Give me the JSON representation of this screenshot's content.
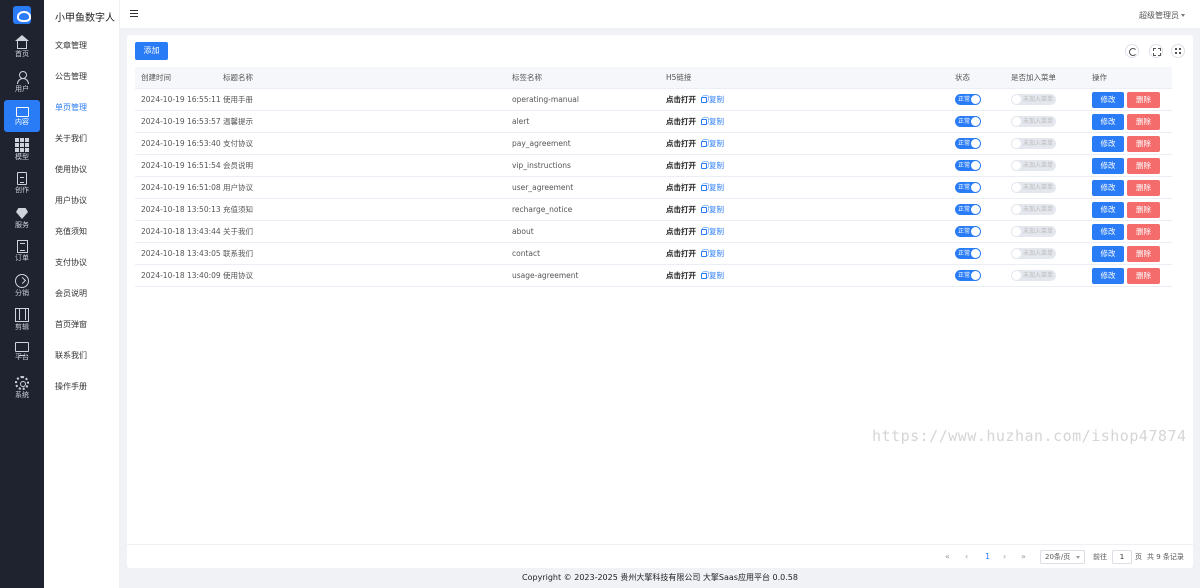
{
  "rail": {
    "items": [
      {
        "label": "首页",
        "icon": "home-icon"
      },
      {
        "label": "用户",
        "icon": "user-icon"
      },
      {
        "label": "内容",
        "icon": "folder-icon"
      },
      {
        "label": "模型",
        "icon": "grid-icon"
      },
      {
        "label": "创作",
        "icon": "document-icon"
      },
      {
        "label": "服务",
        "icon": "gem-icon"
      },
      {
        "label": "订单",
        "icon": "book-icon"
      },
      {
        "label": "分销",
        "icon": "share-icon"
      },
      {
        "label": "剪辑",
        "icon": "film-icon"
      },
      {
        "label": "平台",
        "icon": "monitor-icon"
      },
      {
        "label": "系统",
        "icon": "gear-icon"
      }
    ],
    "active_index": 2,
    "accent": "#2a7cf6"
  },
  "submenu": {
    "title": "小甲鱼数字人",
    "items": [
      "文章管理",
      "公告管理",
      "单页管理",
      "关于我们",
      "使用协议",
      "用户协议",
      "充值须知",
      "支付协议",
      "会员说明",
      "首页弹窗",
      "联系我们",
      "操作手册"
    ],
    "active_index": 2
  },
  "header": {
    "admin": "超级管理员"
  },
  "toolbar": {
    "add_label": "添加"
  },
  "table": {
    "headers": [
      "创建时间",
      "标题名称",
      "标签名称",
      "H5链接",
      "状态",
      "是否加入菜单",
      "操作"
    ],
    "open_label": "点击打开",
    "copy_label": "复制",
    "status_on_label": "正常",
    "menu_off_label": "未加入菜单",
    "edit_label": "修改",
    "delete_label": "删除",
    "rows": [
      {
        "time": "2024-10-19 16:55:11",
        "title": "使用手册",
        "tag": "operating-manual"
      },
      {
        "time": "2024-10-19 16:53:57",
        "title": "温馨提示",
        "tag": "alert"
      },
      {
        "time": "2024-10-19 16:53:40",
        "title": "支付协议",
        "tag": "pay_agreement"
      },
      {
        "time": "2024-10-19 16:51:54",
        "title": "会员说明",
        "tag": "vip_instructions"
      },
      {
        "time": "2024-10-19 16:51:08",
        "title": "用户协议",
        "tag": "user_agreement"
      },
      {
        "time": "2024-10-18 13:50:13",
        "title": "充值须知",
        "tag": "recharge_notice"
      },
      {
        "time": "2024-10-18 13:43:44",
        "title": "关于我们",
        "tag": "about"
      },
      {
        "time": "2024-10-18 13:43:05",
        "title": "联系我们",
        "tag": "contact"
      },
      {
        "time": "2024-10-18 13:40:09",
        "title": "使用协议",
        "tag": "usage-agreement"
      }
    ]
  },
  "watermark": "https://www.huzhan.com/ishop47874",
  "pagination": {
    "current_page": "1",
    "page_size": "20条/页",
    "goto_prefix": "前往",
    "goto_value": "1",
    "goto_suffix": "页",
    "total": "共 9 条记录"
  },
  "footer": "Copyright © 2023-2025 贵州大擎科技有限公司  大擎Saas应用平台 0.0.58"
}
